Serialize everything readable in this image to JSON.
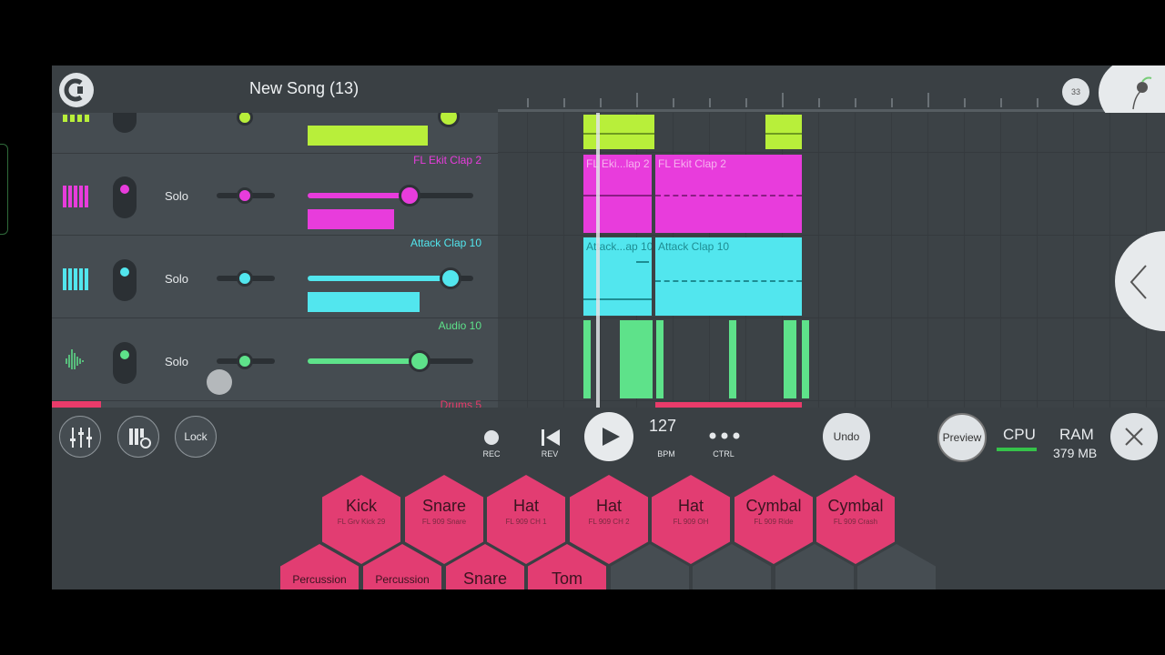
{
  "app": {
    "song_title": "New Song (13)",
    "counter_badge": "33"
  },
  "colors": {
    "accent_pink": "#e93b8a",
    "pad_pink": "#e23d72",
    "lime": "#b8ef3a",
    "magenta": "#e83cdc",
    "cyan": "#52e6ee",
    "green": "#5ee28a"
  },
  "tracks": [
    {
      "name": "",
      "solo_label": "",
      "icon": "grid-icon",
      "color": "#b8ef3a",
      "volume": 0.82
    },
    {
      "name": "FL Ekit Clap 2",
      "solo_label": "Solo",
      "icon": "piano-keys-icon",
      "color": "#e83cdc",
      "volume": 0.62
    },
    {
      "name": "Attack Clap 10",
      "solo_label": "Solo",
      "icon": "piano-keys-icon",
      "color": "#52e6ee",
      "volume": 0.86
    },
    {
      "name": "Audio 10",
      "solo_label": "Solo",
      "icon": "waveform-icon",
      "color": "#5ee28a",
      "volume": 0.67
    },
    {
      "name": "Drums 5",
      "solo_label": "",
      "icon": "",
      "color": "#e93b6a",
      "volume": 0
    }
  ],
  "playlist": {
    "clips": [
      {
        "track": 1,
        "label": "FL Eki...lap 2"
      },
      {
        "track": 1,
        "label": "FL Ekit Clap 2"
      },
      {
        "track": 2,
        "label": "Attack...ap 10"
      },
      {
        "track": 2,
        "label": "Attack Clap 10"
      }
    ]
  },
  "transport": {
    "lock_label": "Lock",
    "rec_label": "REC",
    "rev_label": "REV",
    "bpm_value": "127",
    "bpm_label": "BPM",
    "ctrl_label": "CTRL",
    "undo_label": "Undo",
    "preview_label": "Preview",
    "cpu_label": "CPU",
    "ram_label": "RAM",
    "ram_value": "379 MB"
  },
  "pads": {
    "row1": [
      {
        "title": "Kick",
        "sub": "FL Grv Kick 29"
      },
      {
        "title": "Snare",
        "sub": "FL 909 Snare"
      },
      {
        "title": "Hat",
        "sub": "FL 909 CH 1"
      },
      {
        "title": "Hat",
        "sub": "FL 909 CH 2"
      },
      {
        "title": "Hat",
        "sub": "FL 909 OH"
      },
      {
        "title": "Cymbal",
        "sub": "FL 909 Ride"
      },
      {
        "title": "Cymbal",
        "sub": "FL 909 Crash"
      }
    ],
    "row2": [
      {
        "title": "Percussion"
      },
      {
        "title": "Percussion"
      },
      {
        "title": "Snare"
      },
      {
        "title": "Tom"
      }
    ]
  }
}
